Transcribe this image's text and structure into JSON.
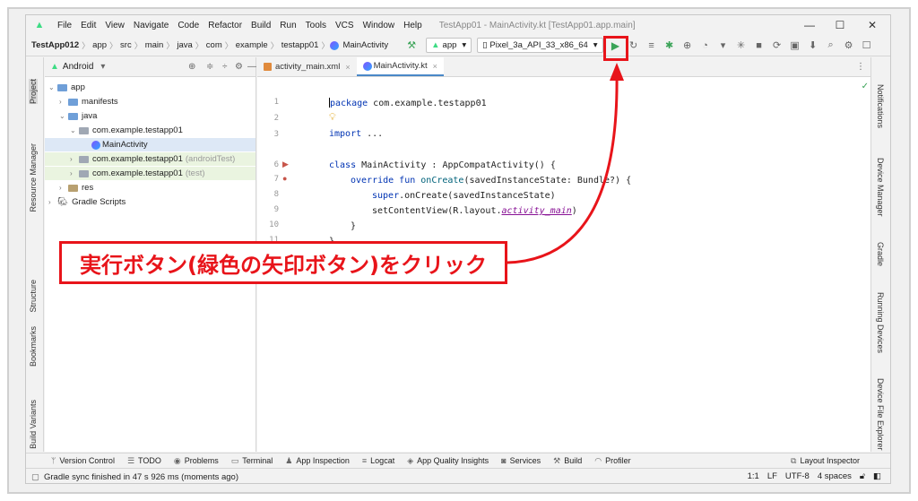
{
  "window": {
    "title": "TestApp01 - MainActivity.kt [TestApp01.app.main]",
    "minimize": "—",
    "maximize": "☐",
    "close": "✕"
  },
  "menu": [
    "File",
    "Edit",
    "View",
    "Navigate",
    "Code",
    "Refactor",
    "Build",
    "Run",
    "Tools",
    "VCS",
    "Window",
    "Help"
  ],
  "breadcrumbs": [
    "TestApp012",
    "app",
    "src",
    "main",
    "java",
    "com",
    "example",
    "testapp01",
    "MainActivity"
  ],
  "toolbar": {
    "run_config": "app",
    "device": "Pixel_3a_API_33_x86_64"
  },
  "left_tools": [
    "Project",
    "Resource Manager",
    "Structure",
    "Bookmarks",
    "Build Variants"
  ],
  "right_tools": [
    "Notifications",
    "Device Manager",
    "Gradle",
    "Running Devices",
    "Device File Explorer"
  ],
  "project_panel": {
    "view": "Android",
    "tree": [
      {
        "label": "app",
        "note": ""
      },
      {
        "label": "manifests",
        "note": ""
      },
      {
        "label": "java",
        "note": ""
      },
      {
        "label": "com.example.testapp01",
        "note": ""
      },
      {
        "label": "MainActivity",
        "note": ""
      },
      {
        "label": "com.example.testapp01",
        "note": "(androidTest)"
      },
      {
        "label": "com.example.testapp01",
        "note": "(test)"
      },
      {
        "label": "res",
        "note": ""
      },
      {
        "label": "Gradle Scripts",
        "note": ""
      }
    ]
  },
  "editor": {
    "tabs": [
      "activity_main.xml",
      "MainActivity.kt"
    ],
    "line_numbers": [
      "1",
      "2",
      "3",
      "6",
      "7",
      "8",
      "9",
      "10",
      "11"
    ],
    "code": {
      "l1_kw": "package",
      "l1_rest": " com.example.testapp01",
      "l3_kw": "import",
      "l3_rest": " ...",
      "l6_kw": "class",
      "l6_rest": " MainActivity : AppCompatActivity() {",
      "l7_kw": "override fun",
      "l7_fn": "onCreate",
      "l7_rest": "(savedInstanceState: Bundle?) {",
      "l8_kw": "super",
      "l8_rest": ".onCreate(savedInstanceState)",
      "l9_pre": "setContentView(R.layout.",
      "l9_it": "activity_main",
      "l9_post": ")",
      "l10": "}",
      "l11": "}"
    }
  },
  "bottom_tools": [
    "Version Control",
    "TODO",
    "Problems",
    "Terminal",
    "App Inspection",
    "Logcat",
    "App Quality Insights",
    "Services",
    "Build",
    "Profiler"
  ],
  "layout_inspector": "Layout Inspector",
  "status": {
    "message": "Gradle sync finished in 47 s 926 ms (moments ago)",
    "position": "1:1",
    "line_sep": "LF",
    "encoding": "UTF-8",
    "indent": "4 spaces"
  },
  "annotation": {
    "text": "実行ボタン(緑色の矢印ボタン)をクリック",
    "color": "#e8141a"
  }
}
